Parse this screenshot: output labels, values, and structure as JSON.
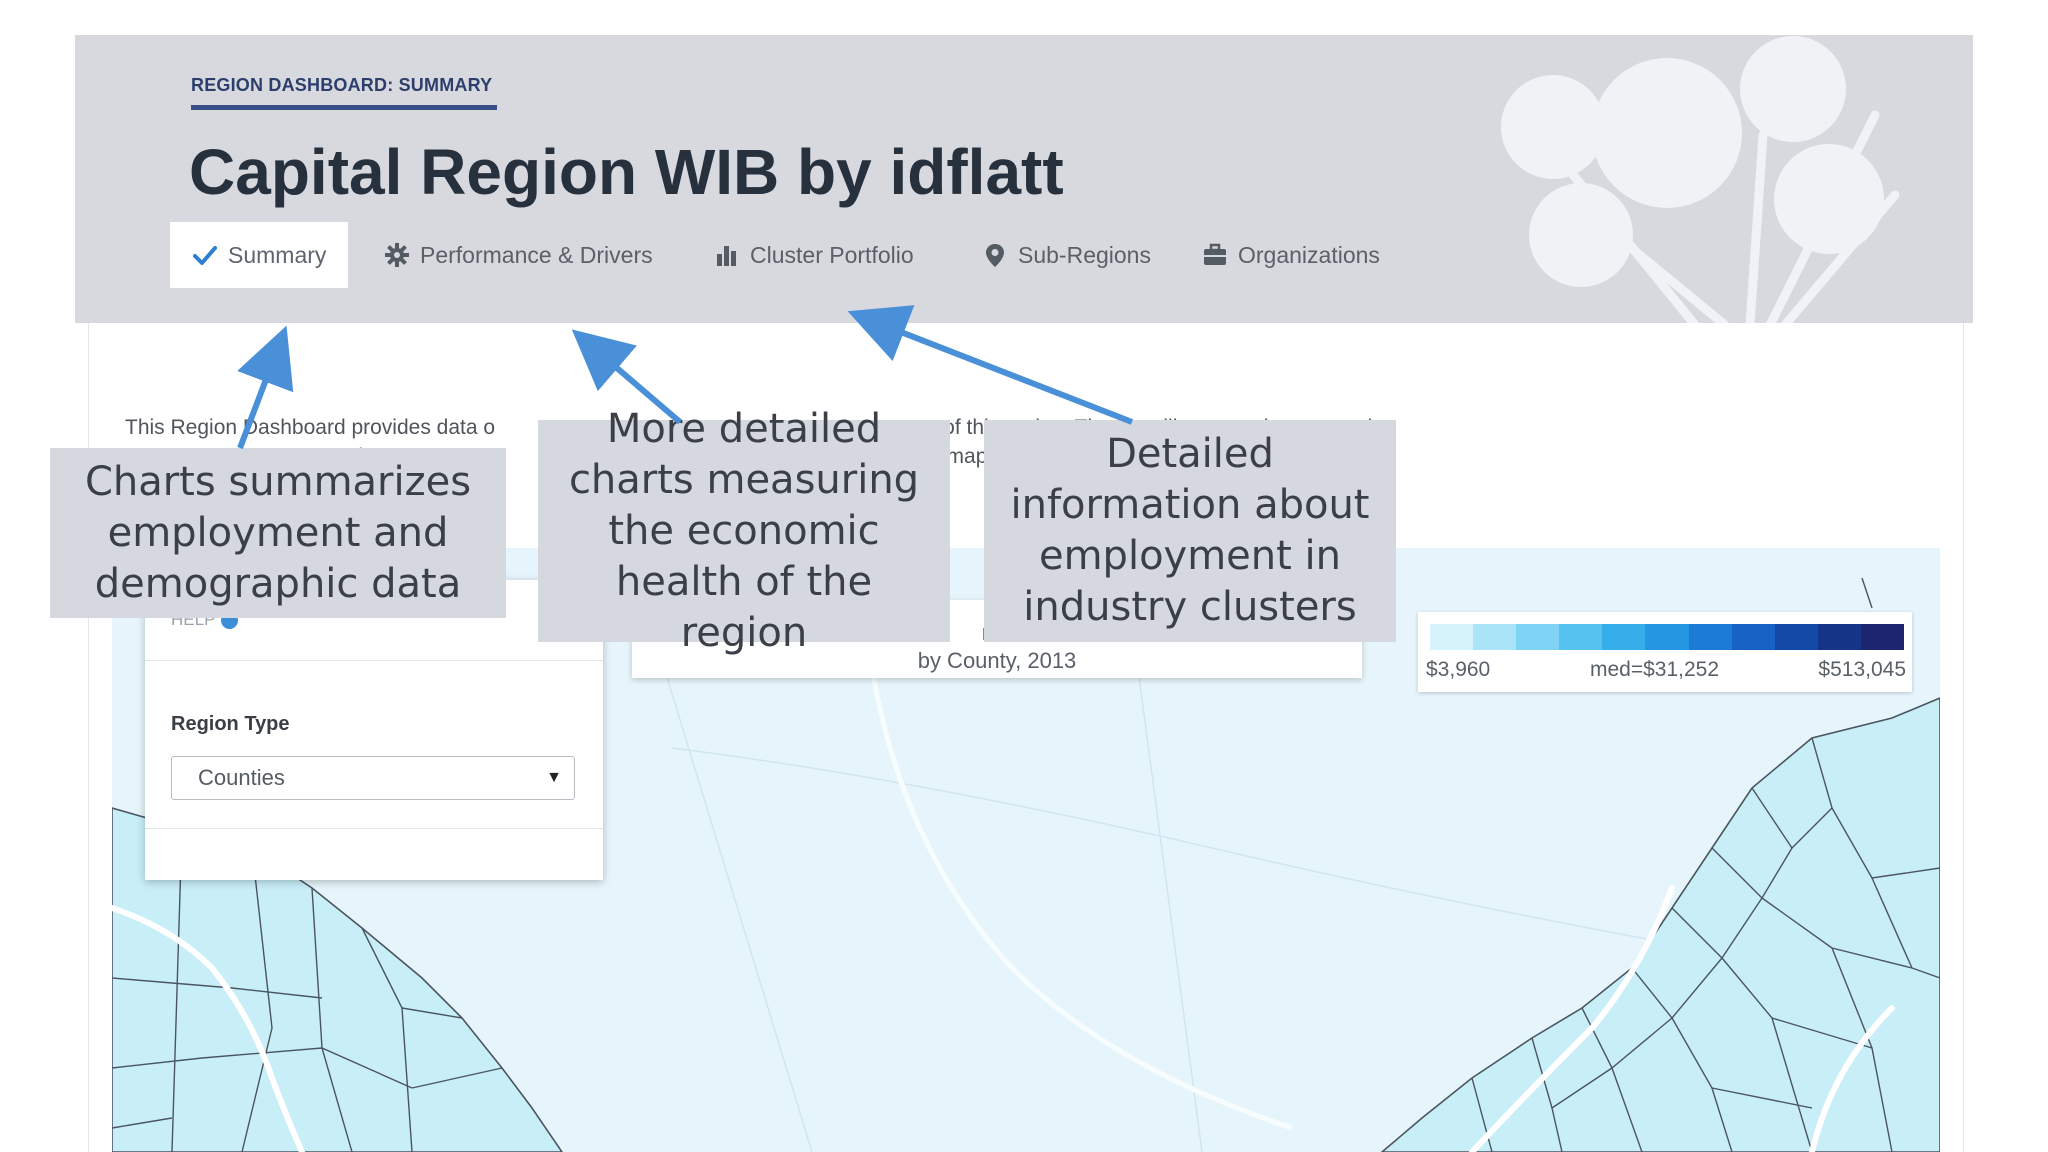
{
  "header": {
    "eyebrow": "REGION DASHBOARD: SUMMARY",
    "title": "Capital Region WIB by idflatt"
  },
  "tabs": [
    {
      "label": "Summary",
      "icon": "check-icon",
      "active": true
    },
    {
      "label": "Performance & Drivers",
      "icon": "gear-icon",
      "active": false
    },
    {
      "label": "Cluster Portfolio",
      "icon": "bar-chart-icon",
      "active": false
    },
    {
      "label": "Sub-Regions",
      "icon": "map-pin-icon",
      "active": false
    },
    {
      "label": "Organizations",
      "icon": "briefcase-icon",
      "active": false
    }
  ],
  "intro": {
    "text": "This Region Dashboard provides data o                              com                                   on of this region. The map illustrates the economic\n                                        k o                                   r to                                   ntrols on the map to adjust the type of data\n                                        di                                    se                                    etailed data."
  },
  "controls": {
    "help_label": "HELP",
    "region_type_label": "Region Type",
    "region_type_value": "Counties"
  },
  "map": {
    "title_fragment": "ros",
    "subtitle": "by County, 2013"
  },
  "legend": {
    "min_label": "$3,960",
    "median_label": "med=$31,252",
    "max_label": "$513,045",
    "colors": [
      "#d6f3fc",
      "#a9e4f8",
      "#7fd3f5",
      "#56c2f0",
      "#36aee9",
      "#2596e2",
      "#1b7bd6",
      "#1762c4",
      "#1449a8",
      "#163488",
      "#1c2670"
    ]
  },
  "callouts": {
    "summary": "Charts summarizes employment and demographic data",
    "performance": "More detailed charts measuring the economic health of the region",
    "cluster": "Detailed information about employment in industry clusters"
  },
  "colors": {
    "header_bg": "#d8d9df",
    "title_text": "#27303d",
    "arrow": "#4a90d9",
    "map_fill": "#e6f5fb",
    "callout_bg": "#d5d8de"
  }
}
